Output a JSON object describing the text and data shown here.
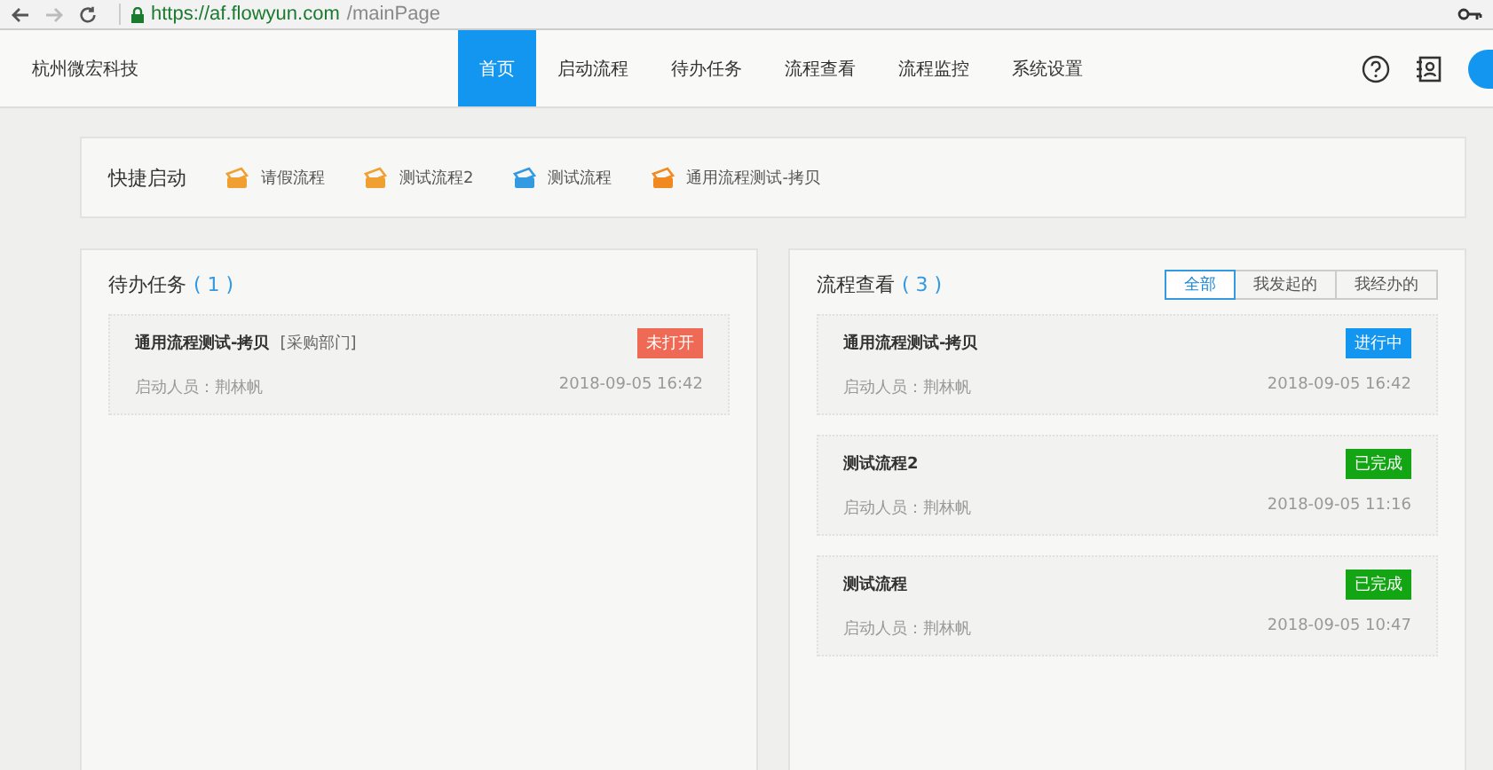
{
  "browser": {
    "url_host": "https://af.flowyun.com",
    "url_path": "/mainPage"
  },
  "header": {
    "brand": "杭州微宏科技",
    "tabs": [
      {
        "label": "首页",
        "selected": true
      },
      {
        "label": "启动流程",
        "selected": false
      },
      {
        "label": "待办任务",
        "selected": false
      },
      {
        "label": "流程查看",
        "selected": false
      },
      {
        "label": "流程监控",
        "selected": false
      },
      {
        "label": "系统设置",
        "selected": false
      }
    ]
  },
  "quick_start": {
    "title": "快捷启动",
    "items": [
      {
        "label": "请假流程",
        "color": "#f0a030"
      },
      {
        "label": "测试流程2",
        "color": "#f0a030"
      },
      {
        "label": "测试流程",
        "color": "#3399e0"
      },
      {
        "label": "通用流程测试-拷贝",
        "color": "#f08a20"
      }
    ]
  },
  "todo": {
    "title": "待办任务",
    "count": "( 1 )",
    "items": [
      {
        "name": "通用流程测试-拷贝",
        "dept": "[采购部门]",
        "status": {
          "label": "未打开",
          "kind": "unopened"
        },
        "starter": "启动人员：荆林帆",
        "time": "2018-09-05 16:42"
      }
    ]
  },
  "processes": {
    "title": "流程查看",
    "count": "( 3 )",
    "filters": [
      {
        "label": "全部",
        "selected": true
      },
      {
        "label": "我发起的",
        "selected": false
      },
      {
        "label": "我经办的",
        "selected": false
      }
    ],
    "items": [
      {
        "name": "通用流程测试-拷贝",
        "status": {
          "label": "进行中",
          "kind": "running"
        },
        "starter": "启动人员：荆林帆",
        "time": "2018-09-05 16:42"
      },
      {
        "name": "测试流程2",
        "status": {
          "label": "已完成",
          "kind": "done"
        },
        "starter": "启动人员：荆林帆",
        "time": "2018-09-05 11:16"
      },
      {
        "name": "测试流程",
        "status": {
          "label": "已完成",
          "kind": "done"
        },
        "starter": "启动人员：荆林帆",
        "time": "2018-09-05 10:47"
      }
    ]
  }
}
